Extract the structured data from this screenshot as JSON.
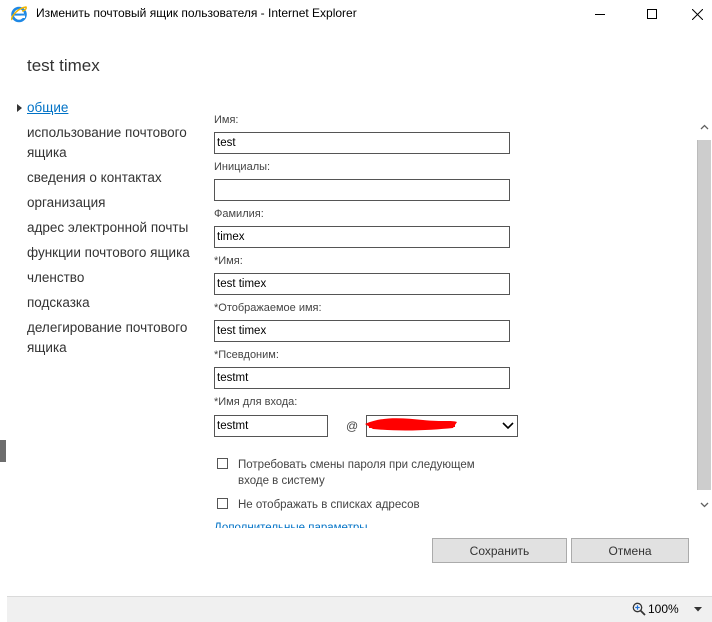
{
  "window": {
    "title": "Изменить почтовый ящик пользователя - Internet Explorer"
  },
  "page": {
    "title": "test timex"
  },
  "nav": {
    "items": [
      {
        "label": "общие",
        "active": true
      },
      {
        "label": "использование почтового ящика"
      },
      {
        "label": "сведения о контактах"
      },
      {
        "label": "организация"
      },
      {
        "label": "адрес электронной почты"
      },
      {
        "label": "функции почтового ящика"
      },
      {
        "label": "членство"
      },
      {
        "label": "подсказка"
      },
      {
        "label": "делегирование почтового ящика"
      }
    ]
  },
  "form": {
    "first_name": {
      "label": "Имя:",
      "value": "test"
    },
    "initials": {
      "label": "Инициалы:",
      "value": ""
    },
    "last_name": {
      "label": "Фамилия:",
      "value": "timex"
    },
    "name": {
      "label": "*Имя:",
      "value": "test timex"
    },
    "display_name": {
      "label": "*Отображаемое имя:",
      "value": "test timex"
    },
    "alias": {
      "label": "*Псевдоним:",
      "value": "testmt"
    },
    "logon_name": {
      "label": "*Имя для входа:",
      "value": "testmt",
      "at": "@"
    },
    "require_password_change": {
      "label": "Потребовать смены пароля при следующем входе в систему",
      "checked": false
    },
    "hide_from_address_lists": {
      "label": "Не отображать в списках адресов",
      "checked": false
    },
    "more_options": "Дополнительные параметры..."
  },
  "buttons": {
    "save": "Сохранить",
    "cancel": "Отмена"
  },
  "status": {
    "zoom": "100%"
  },
  "colors": {
    "accent": "#0072c6",
    "redaction": "#ff0000"
  }
}
